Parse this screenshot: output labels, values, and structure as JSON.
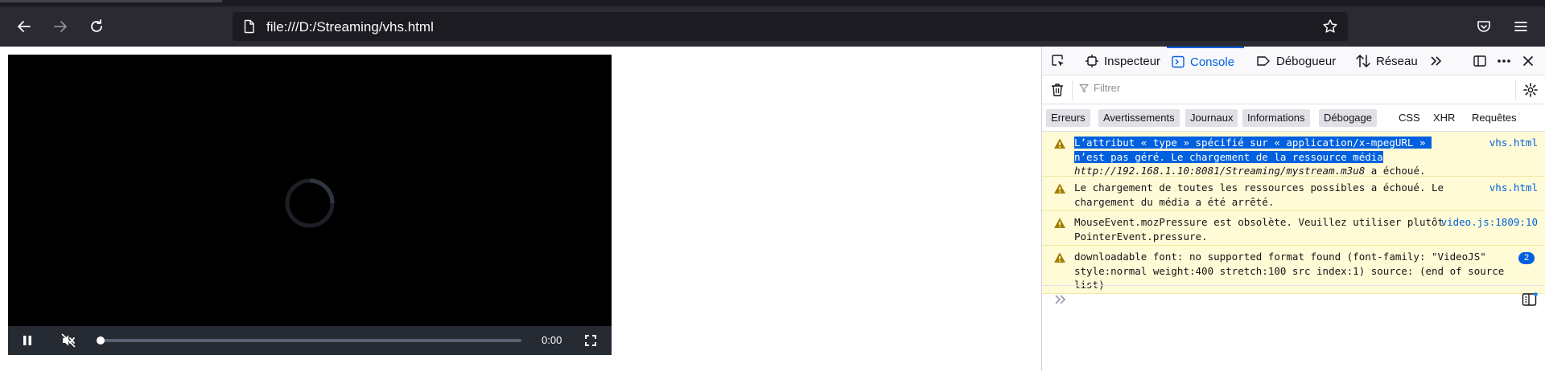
{
  "browser": {
    "url": "file:///D:/Streaming/vhs.html",
    "icons": [
      "back-icon",
      "forward-icon",
      "reload-icon",
      "page-icon",
      "star-icon",
      "pocket-icon",
      "menu-icon"
    ]
  },
  "player": {
    "time": "0:00",
    "progress": 0.0,
    "icons": [
      "loading-spinner",
      "pause-icon",
      "mute-icon",
      "fullscreen-icon"
    ]
  },
  "devtools": {
    "tabs": [
      {
        "label": "Inspecteur",
        "icon": "inspector-icon"
      },
      {
        "label": "Console",
        "icon": "console-icon",
        "active": true
      },
      {
        "label": "Débogueur",
        "icon": "debugger-icon"
      },
      {
        "label": "Réseau",
        "icon": "network-icon"
      }
    ],
    "filter_placeholder": "Filtrer",
    "levels": [
      {
        "label": "Erreurs",
        "on": true
      },
      {
        "label": "Avertissements",
        "on": true
      },
      {
        "label": "Journaux",
        "on": true
      },
      {
        "label": "Informations",
        "on": true
      },
      {
        "label": "Débogage",
        "on": true
      },
      {
        "label": "CSS",
        "on": false
      },
      {
        "label": "XHR",
        "on": false
      },
      {
        "label": "Requêtes",
        "on": false
      }
    ],
    "messages": [
      {
        "highlight": "L’attribut « type » spécifié sur « application/x-mpegURL » n’est pas géré. Le chargement de la ressource média",
        "url": "http://192.168.1.10:8081/Streaming/mystream.m3u8",
        "tail": " a échoué.",
        "source": "vhs.html"
      },
      {
        "text": "Le chargement de toutes les ressources possibles a échoué. Le chargement du média a été arrêté.",
        "source": "vhs.html"
      },
      {
        "text": "MouseEvent.mozPressure est obsolète. Veuillez utiliser plutôt PointerEvent.pressure.",
        "source": "video.js:1809:10"
      },
      {
        "text": "downloadable font: no supported format found (font-family: \"VideoJS\" style:normal weight:400 stretch:100 src index:1) source: (end of source list)",
        "count": "2"
      }
    ],
    "colors": {
      "accent": "#0060df",
      "warning_bg": "#fffbd6",
      "warning_icon": "#a47f00"
    }
  }
}
